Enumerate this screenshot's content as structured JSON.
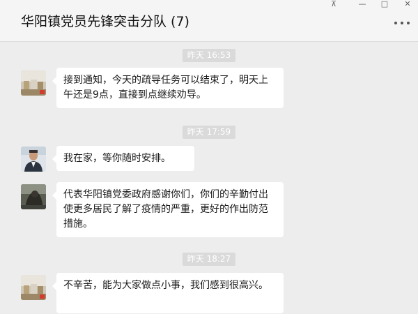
{
  "window": {
    "title": "华阳镇党员先锋突击分队 (7)",
    "controls": {
      "pin": "⊼",
      "minimize": "—",
      "maximize": "□",
      "close": "✕"
    }
  },
  "messages": [
    {
      "time": "昨天 16:53"
    },
    {
      "avatar": "avatar-room",
      "text": "接到通知，今天的疏导任务可以结束了，明天上午还是9点，直接到点继续劝导。"
    },
    {
      "time": "昨天 17:59"
    },
    {
      "avatar": "avatar-man",
      "text": "我在家，等你随时安排。"
    },
    {
      "avatar": "avatar-dark",
      "text": "代表华阳镇党委政府感谢你们，你们的辛勤付出使更多居民了解了疫情的严重，更好的作出防范措施。"
    },
    {
      "time": "昨天 18:27"
    },
    {
      "avatar": "avatar-room",
      "text": "不辛苦，能为大家做点小事，我们感到很高兴。"
    }
  ]
}
